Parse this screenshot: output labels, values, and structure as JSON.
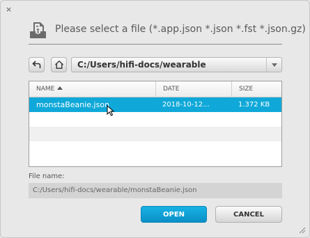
{
  "dialog": {
    "close_glyph": "×",
    "title": "Please select a file (*.app.json *.json *.fst *.json.gz)",
    "header_icon": "file-upload-icon"
  },
  "navigation": {
    "back_icon": "back-arrow-icon",
    "home_icon": "home-icon",
    "current_path": "C:/Users/hifi-docs/wearable",
    "dropdown_icon": "chevron-down-icon"
  },
  "file_table": {
    "columns": [
      {
        "label": "NAME",
        "sorted": "ascending"
      },
      {
        "label": "DATE"
      },
      {
        "label": "SIZE"
      }
    ],
    "rows": [
      {
        "name": "monstaBeanie.json",
        "date": "2018-10-12...",
        "size": "1.372 KB",
        "selected": true
      }
    ]
  },
  "file_name": {
    "label": "File name:",
    "value": "C:/Users/hifi-docs/wearable/monstaBeanie.json"
  },
  "buttons": {
    "open": "OPEN",
    "cancel": "CANCEL"
  },
  "colors": {
    "accent": "#0fa8d8",
    "background": "#e8e8e8"
  }
}
